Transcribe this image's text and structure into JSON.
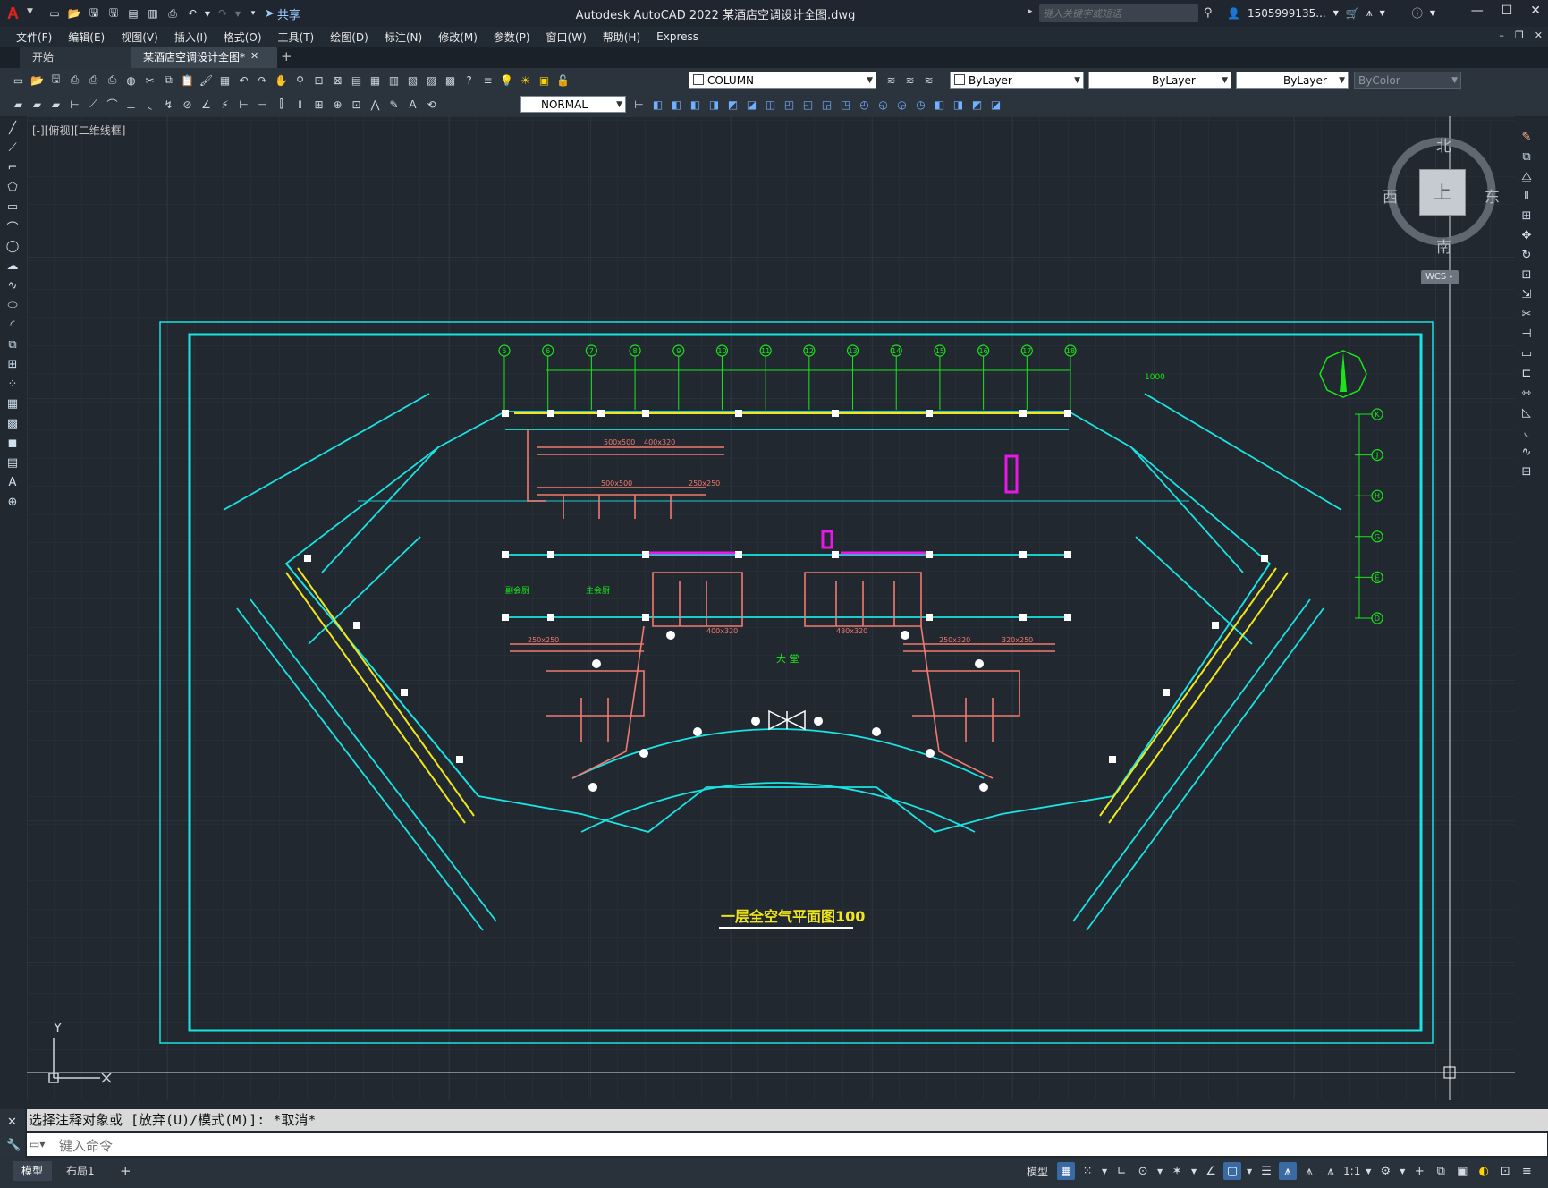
{
  "app": {
    "title": "Autodesk AutoCAD 2022    某酒店空调设计全图.dwg",
    "share_label": "共享",
    "search_placeholder": "键入关键字或短语",
    "user_name": "1505999135...",
    "logo_letter": "A"
  },
  "menu": [
    "文件(F)",
    "编辑(E)",
    "视图(V)",
    "插入(I)",
    "格式(O)",
    "工具(T)",
    "绘图(D)",
    "标注(N)",
    "修改(M)",
    "参数(P)",
    "窗口(W)",
    "帮助(H)",
    "Express"
  ],
  "tabs": {
    "start": "开始",
    "document": "某酒店空调设计全图*"
  },
  "toolbar": {
    "layer_name": "COLUMN",
    "color": "ByLayer",
    "linetype": "ByLayer",
    "lineweight": "ByLayer",
    "plotstyle": "ByColor",
    "dimstyle": "NORMAL"
  },
  "viewport": {
    "label": "[-][俯视][二维线框]"
  },
  "viewcube": {
    "north": "北",
    "south": "南",
    "west": "西",
    "east": "东",
    "top": "上",
    "wcs": "WCS"
  },
  "ucs": {
    "y": "Y"
  },
  "drawing": {
    "title": "一层全空气平面图100",
    "labels": {
      "lobby": "大  堂",
      "main_kitchen": "主会厨",
      "sub_kitchen": "副会厨",
      "dim_note": "1000"
    },
    "grid_top": [
      "5",
      "6",
      "7",
      "8",
      "9",
      "10",
      "11",
      "12",
      "13",
      "14",
      "15",
      "16",
      "17",
      "18"
    ],
    "grid_right": [
      "K",
      "J",
      "H",
      "G",
      "E",
      "D"
    ],
    "duct_sizes": [
      "500x500",
      "400x320",
      "250x250",
      "320x250",
      "480x320",
      "250x320"
    ]
  },
  "command": {
    "history": "选择注释对象或 [放弃(U)/模式(M)]: *取消*",
    "placeholder": "键入命令"
  },
  "status": {
    "tab_model": "模型",
    "tab_layout": "布局1",
    "model_label": "模型",
    "scale": "1:1"
  },
  "colors": {
    "background": "#212830",
    "cyan": "#19e3e3",
    "green": "#19e619",
    "salmon": "#f07a70",
    "yellow": "#f0e619",
    "magenta": "#e619e6"
  }
}
